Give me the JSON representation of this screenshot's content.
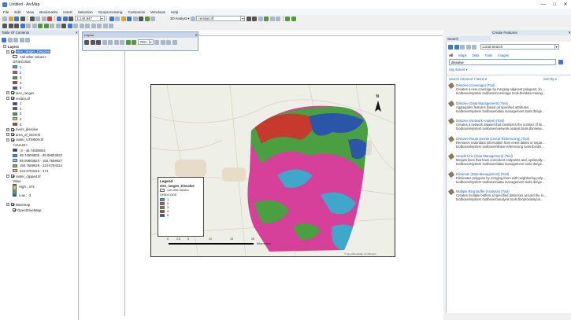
{
  "window": {
    "title": "Untitled - ArcMap",
    "minimize": "—",
    "maximize": "□",
    "close": "✕"
  },
  "menu": [
    "File",
    "Edit",
    "View",
    "Bookmarks",
    "Insert",
    "Selection",
    "Geoprocessing",
    "Customize",
    "Windows",
    "Help"
  ],
  "toolbar": {
    "scale": "1:144,847",
    "analyst_label": "3D Analyst ▾",
    "layer_combo": "reclass.tif"
  },
  "toc": {
    "title": "Table Of Contents",
    "root": "Layers",
    "layers": [
      {
        "name": "elev_ranges_Dissolve",
        "sublabel": "<all other values>",
        "field": "GRIDCODE",
        "classes": [
          "1",
          "2",
          "3",
          "4",
          "5"
        ],
        "colors": [
          "#3fa7c9",
          "#d6409b",
          "#4aa040",
          "#c53a2c",
          "#2a55a8"
        ]
      },
      {
        "name": "elev_ranges"
      },
      {
        "name": "reclass.tif",
        "classes": [
          "1",
          "2",
          "3",
          "4",
          "5"
        ],
        "colors": [
          "#2b4aa0",
          "#7a3b9d",
          "#3fa34a",
          "#c8dd5a",
          "#c53a2c"
        ]
      },
      {
        "name": "rivers_dissolve"
      },
      {
        "name": "area_of_interest"
      },
      {
        "name": "raster_UTM50N.tif",
        "field": "<VALUE>",
        "classes": [
          "-3 - 48.74509804",
          "48.74509805 - 95.09803922",
          "95.09803923 - 150.7568627",
          "150.7568628 - 224.6784314",
          "224.6784315 - 374"
        ],
        "colors": [
          "#1f3f9a",
          "#3c8fd1",
          "#8dcbe6",
          "#6ab96c",
          "#f2c84b"
        ]
      },
      {
        "name": "raster_clipped.tif",
        "field": "Value",
        "high": "High : 374",
        "low": "Low : -3"
      },
      {
        "name": "Basemap",
        "child": "OpenStreetMap"
      }
    ]
  },
  "drawing_toolbar": {
    "title": "Layout",
    "zoom": "75%"
  },
  "legend": {
    "title": "Legend",
    "layer": "elev_ranges_Dissolve",
    "other": "<all other values>",
    "field": "GRIDCODE",
    "classes": [
      "1",
      "2",
      "3",
      "4",
      "5"
    ],
    "colors": [
      "#3fa7c9",
      "#d6409b",
      "#4aa040",
      "#c53a2c",
      "#2a55a8"
    ]
  },
  "scalebar": {
    "labels": [
      "0",
      "2.5",
      "5",
      "10",
      "15",
      "20"
    ],
    "unit": "Kilometers"
  },
  "north": "N",
  "attribution": "© OpenStreetMap contributors",
  "search": {
    "title": "Search",
    "location": "Local Search",
    "query": "dissolve",
    "tabs": [
      "All",
      "Maps",
      "Data",
      "Tools",
      "Images"
    ],
    "any_extent": "Any Extent ▾",
    "returned": "Search returned 7 items ▾",
    "sort": "Sort By ▾",
    "results": [
      {
        "title": "Dissolve (Coverage) (Tool)",
        "desc": "Creates a new coverage by merging adjacent polygons, lin...",
        "path": "toolboxes\\system toolboxes\\coverage tools.tbx\\data manag..."
      },
      {
        "title": "Dissolve (Data Management) (Tool)",
        "desc": "Aggregates features based on specified attributes.",
        "path": "toolboxes\\system toolboxes\\data management tools.tbx\\ge..."
      },
      {
        "title": "Dissolve (Network Analyst) (Tool)",
        "desc": "Creates a network dataset that minimizes the number of lin...",
        "path": "toolboxes\\system toolboxes\\network analyst tools.tbx\\netw..."
      },
      {
        "title": "Dissolve Route Events (Linear Referencing) (Tool)",
        "desc": "Removes redundant information from event tables or separ...",
        "path": "toolboxes\\system toolboxes\\linear referencing tools.tbx\\dis..."
      },
      {
        "title": "Unsplit Line (Data Management) (Tool)",
        "desc": "Merges lines that have coincident endpoints and, optionally...",
        "path": "toolboxes\\system toolboxes\\data management tools.tbx\\ge..."
      },
      {
        "title": "Eliminate (Data Management) (Tool)",
        "desc": "Eliminates polygons by merging them with neighboring poly...",
        "path": "toolboxes\\system toolboxes\\data management tools.tbx\\ge..."
      },
      {
        "title": "Multiple Ring Buffer (Analysis) (Tool)",
        "desc": "Creates multiple buffers at specified distances around the in...",
        "path": "toolboxes\\system toolboxes\\analysis tools.tbx\\proximity\\m..."
      }
    ]
  },
  "create_features": {
    "title": "Create Features"
  }
}
